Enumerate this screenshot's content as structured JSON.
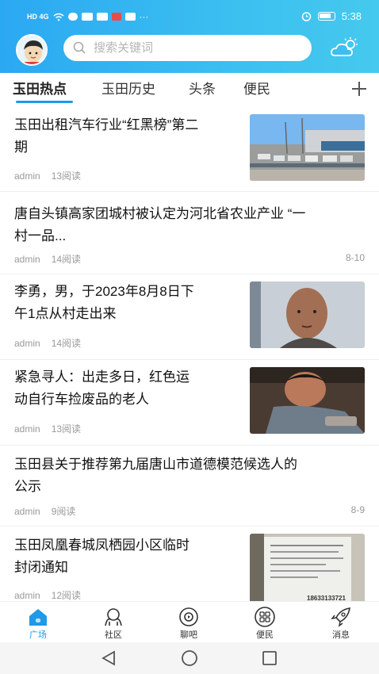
{
  "status": {
    "time": "5:38",
    "left_icons": "HD 4G",
    "wifi": "wifi-icon"
  },
  "search": {
    "placeholder": "搜索关键词"
  },
  "tabs": [
    {
      "label": "玉田热点",
      "active": true
    },
    {
      "label": "玉田历史"
    },
    {
      "label": "头条"
    },
    {
      "label": "便民"
    }
  ],
  "feed": [
    {
      "title_line1": "玉田出租汽车行业“红黑榜”第二",
      "title_line2": "期",
      "author": "admin",
      "reads": "13阅读"
    },
    {
      "title_line1": "唐自头镇高家团城村被认定为河北省农业产业 “一",
      "title_line2": "村一品...",
      "author": "admin",
      "reads": "14阅读",
      "date": "8-10"
    },
    {
      "title_line1": "李勇，男，于2023年8月8日下",
      "title_line2": "午1点从村走出来",
      "author": "admin",
      "reads": "14阅读"
    },
    {
      "title_line1": "紧急寻人：出走多日，红色运",
      "title_line2": "动自行车捡废品的老人",
      "author": "admin",
      "reads": "13阅读"
    },
    {
      "title_line1": "玉田县关于推荐第九届唐山市道德模范候选人的",
      "title_line2": "公示",
      "author": "admin",
      "reads": "9阅读",
      "date": "8-9"
    },
    {
      "title_line1": "玉田凤凰春城凤栖园小区临时",
      "title_line2": "封闭通知",
      "author": "admin",
      "reads": "12阅读"
    }
  ],
  "notice_phone": "18633133721",
  "tabbar": [
    {
      "label": "广场",
      "icon": "home-icon",
      "active": true
    },
    {
      "label": "社区",
      "icon": "community-icon"
    },
    {
      "label": "聊吧",
      "icon": "chat-icon"
    },
    {
      "label": "便民",
      "icon": "grid-icon"
    },
    {
      "label": "消息",
      "icon": "message-icon"
    }
  ],
  "colors": {
    "accent": "#1e9ae8",
    "header_start": "#2ba8f2",
    "header_end": "#45c9ee"
  }
}
